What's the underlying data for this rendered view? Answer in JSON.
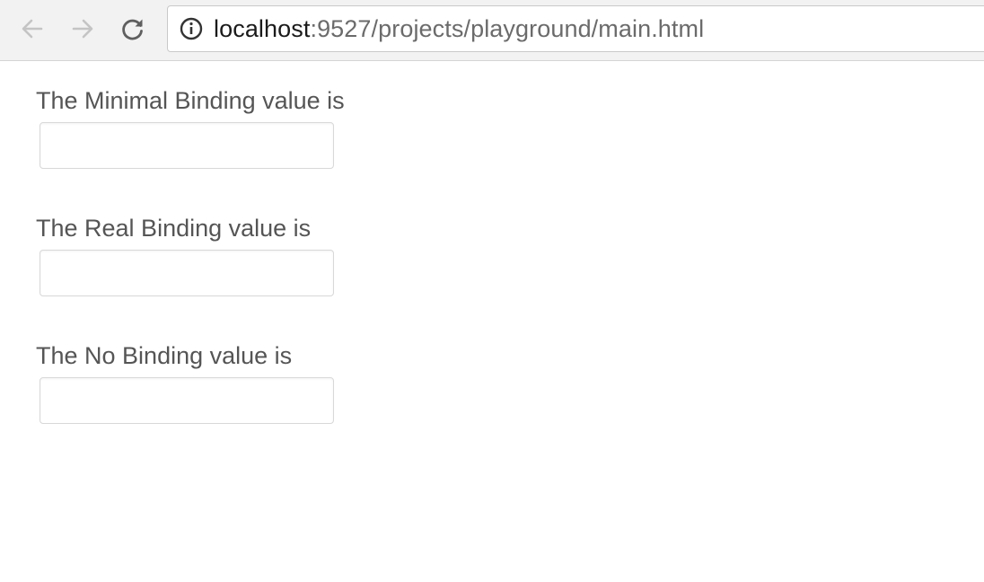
{
  "browser": {
    "url_host": "localhost",
    "url_rest": ":9527/projects/playground/main.html",
    "icons": {
      "back": "arrow-left-icon",
      "forward": "arrow-right-icon",
      "reload": "reload-icon",
      "site_info": "info-circle-icon"
    }
  },
  "form": {
    "fields": [
      {
        "label": "The Minimal Binding value is",
        "value": ""
      },
      {
        "label": "The Real Binding value is",
        "value": ""
      },
      {
        "label": "The No Binding value is",
        "value": ""
      }
    ]
  },
  "colors": {
    "label_text": "#555555",
    "toolbar_bg": "#f2f2f2",
    "url_host": "#1a1a1a",
    "url_rest": "#6b6b6b"
  }
}
